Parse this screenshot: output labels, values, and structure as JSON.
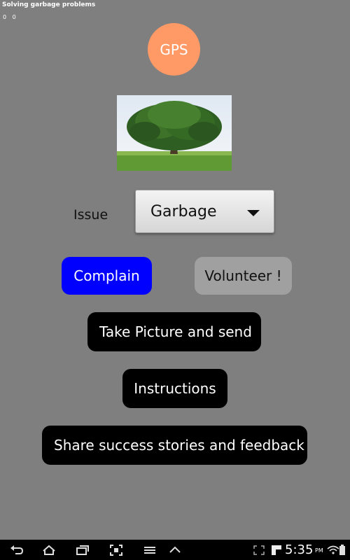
{
  "app": {
    "title": "Solving garbage problems",
    "coords": "0 0"
  },
  "main": {
    "gps_label": "GPS",
    "issue_label": "Issue",
    "issue_selected": "Garbage",
    "complain_label": "Complain",
    "volunteer_label": "Volunteer !",
    "take_picture_label": "Take Picture and send",
    "instructions_label": "Instructions",
    "share_label": "Share success stories and feedback"
  },
  "status": {
    "time": "5:35",
    "ampm": "PM"
  },
  "colors": {
    "background": "#7f7f7f",
    "gps": "#ff9966",
    "complain": "#0000ff",
    "volunteer": "#a0a0a0",
    "dark_button": "#000000"
  },
  "icons": [
    "back-icon",
    "home-icon",
    "recent-apps-icon",
    "screenshot-icon",
    "menu-icon",
    "up-icon",
    "fullscreen-icon",
    "flipboard-icon",
    "wifi-icon",
    "battery-icon"
  ]
}
